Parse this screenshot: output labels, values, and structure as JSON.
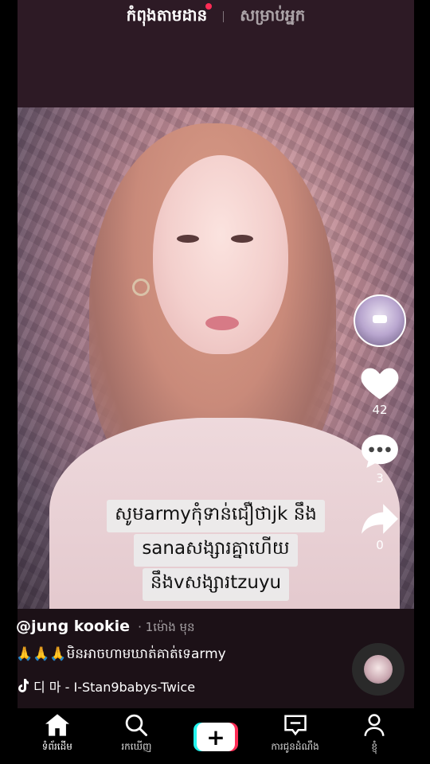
{
  "tabs": {
    "following": "កំពុងតាមដាន",
    "for_you": "សម្រាប់អ្នក"
  },
  "caption_lines": [
    "សូមarmyកុំទាន់ជឿថាjk នឹង",
    "sanaសង្សារគ្នាហើយ",
    "នឹងvសង្សារtzuyu"
  ],
  "actions": {
    "likes": "42",
    "comments": "3",
    "shares": "0"
  },
  "post": {
    "username": "@jung kookie",
    "time": "· 1ម៉ោង មុន",
    "description": "🙏🙏🙏មិនអាចហាមឃាត់គាត់ទេarmy",
    "sound": "디 마 - I-Stan9babys-Twice"
  },
  "nav": {
    "home": "ទំព័រដើម",
    "discover": "រកឃើញ",
    "create": "+",
    "inbox": "ការជូនដំណឹង",
    "me": "ខ្ញុំ"
  },
  "colors": {
    "accent_red": "#fe2c55",
    "accent_cyan": "#25f4ee"
  }
}
